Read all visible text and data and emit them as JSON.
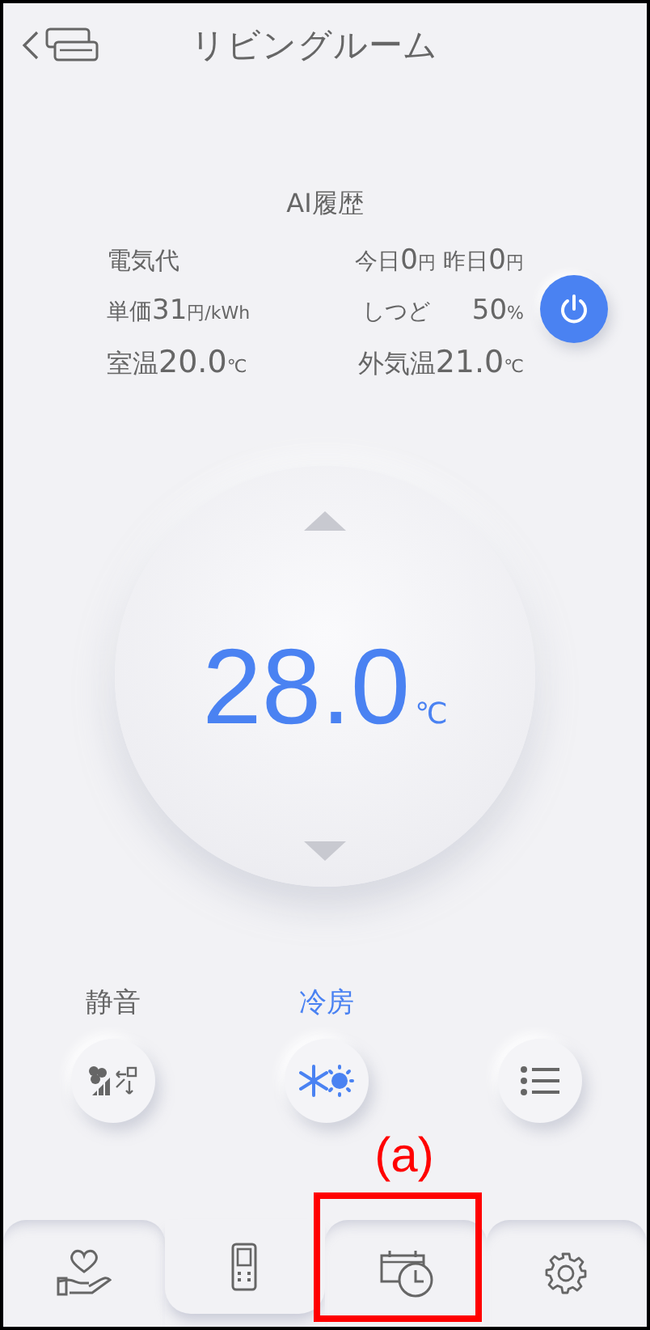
{
  "header": {
    "title": "リビングルーム"
  },
  "history_title": "AI履歴",
  "info": {
    "cost": {
      "label": "電気代",
      "today": {
        "label": "今日",
        "value": "0",
        "unit": "円"
      },
      "yesterday": {
        "label": "昨日",
        "value": "0",
        "unit": "円"
      }
    },
    "price": {
      "label": "単価",
      "value": "31",
      "unit": "円/kWh"
    },
    "humidity": {
      "label": "しつど",
      "value": "50",
      "unit": "%"
    },
    "room_temp": {
      "label": "室温",
      "value": "20.0",
      "unit": "℃"
    },
    "outdoor_temp": {
      "label": "外気温",
      "value": "21.0",
      "unit": "℃"
    }
  },
  "power": {
    "on": true
  },
  "set_temperature": {
    "value": "28.0",
    "unit": "℃"
  },
  "modes": [
    {
      "kind": "fan-speed",
      "label": "静音",
      "selected": false
    },
    {
      "kind": "cool-heat",
      "label": "冷房",
      "selected": true
    },
    {
      "kind": "menu",
      "selected": false
    }
  ],
  "nav_tabs": [
    {
      "kind": "care",
      "selected": false
    },
    {
      "kind": "remote",
      "selected": true
    },
    {
      "kind": "schedule",
      "selected": false
    },
    {
      "kind": "settings",
      "selected": false
    }
  ],
  "annotation": {
    "label": "(a)"
  }
}
